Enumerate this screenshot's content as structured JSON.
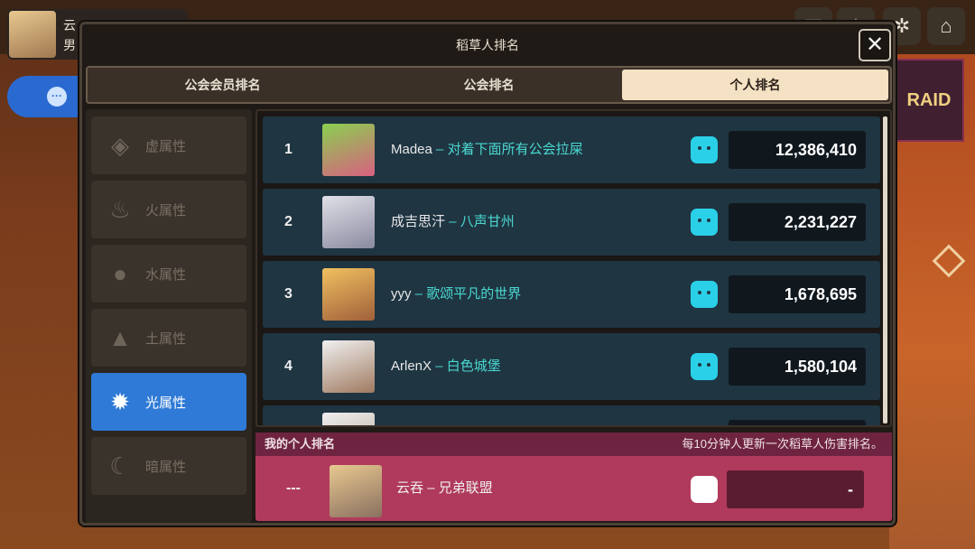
{
  "background": {
    "raid_label": "RAID"
  },
  "profile": {
    "name": "云",
    "gender": "男"
  },
  "modal": {
    "title": "稻草人排名",
    "close_label": "✕"
  },
  "tabs": [
    {
      "label": "公会会员排名",
      "active": false
    },
    {
      "label": "公会排名",
      "active": false
    },
    {
      "label": "个人排名",
      "active": true
    }
  ],
  "attributes": [
    {
      "label": "虚属性",
      "icon": "void-icon",
      "active": false
    },
    {
      "label": "火属性",
      "icon": "fire-icon",
      "active": false
    },
    {
      "label": "水属性",
      "icon": "water-icon",
      "active": false
    },
    {
      "label": "土属性",
      "icon": "earth-icon",
      "active": false
    },
    {
      "label": "光属性",
      "icon": "light-icon",
      "active": true
    },
    {
      "label": "暗属性",
      "icon": "dark-icon",
      "active": false
    }
  ],
  "rankings": [
    {
      "rank": "1",
      "name": "Madea",
      "guild": "对着下面所有公会拉屎",
      "score": "12,386,410"
    },
    {
      "rank": "2",
      "name": "成吉思汗",
      "guild": "八声甘州",
      "score": "2,231,227"
    },
    {
      "rank": "3",
      "name": "yyy",
      "guild": "歌颂平凡的世界",
      "score": "1,678,695"
    },
    {
      "rank": "4",
      "name": "ArlenX",
      "guild": "白色城堡",
      "score": "1,580,104"
    }
  ],
  "my_ranking": {
    "header": "我的个人排名",
    "note": "每10分钟人更新一次稻草人伤害排名。",
    "rank": "---",
    "name": "云吞",
    "guild": "兄弟联盟",
    "score": "-"
  },
  "separator": "–"
}
